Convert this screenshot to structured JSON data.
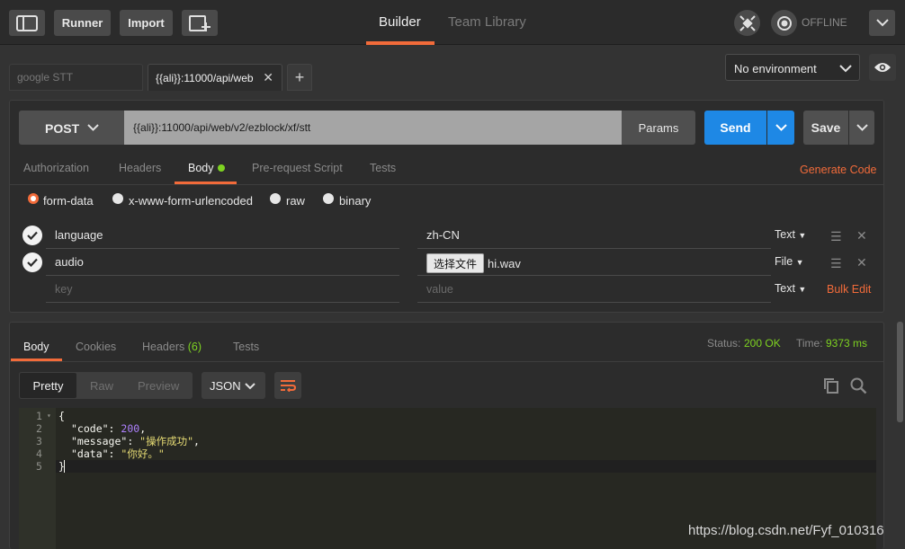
{
  "topbar": {
    "runner_label": "Runner",
    "import_label": "Import",
    "builder_tab": "Builder",
    "team_library_tab": "Team Library",
    "offline_label": "OFFLINE"
  },
  "request_tabs": [
    {
      "label": "google STT"
    },
    {
      "label": "{{ali}}:11000/api/web"
    }
  ],
  "environment": {
    "selected": "No environment"
  },
  "request": {
    "method": "POST",
    "url": "{{ali}}:11000/api/web/v2/ezblock/xf/stt",
    "params_label": "Params",
    "send_label": "Send",
    "save_label": "Save"
  },
  "request_subtabs": {
    "authorization": "Authorization",
    "headers": "Headers",
    "body": "Body",
    "prerequest": "Pre-request Script",
    "tests": "Tests",
    "generate_code": "Generate Code"
  },
  "body_modes": {
    "form_data": "form-data",
    "urlencoded": "x-www-form-urlencoded",
    "raw": "raw",
    "binary": "binary"
  },
  "form_rows": [
    {
      "key": "language",
      "value": "zh-CN",
      "type": "Text"
    },
    {
      "key": "audio",
      "file_button": "选择文件",
      "value": "hi.wav",
      "type": "File"
    }
  ],
  "form_new_row": {
    "key_placeholder": "key",
    "value_placeholder": "value",
    "type": "Text",
    "bulk_edit": "Bulk Edit"
  },
  "response_tabs": {
    "body": "Body",
    "cookies": "Cookies",
    "headers": "Headers",
    "headers_count": "(6)",
    "tests": "Tests"
  },
  "response_status": {
    "status_label": "Status:",
    "status_value": "200 OK",
    "time_label": "Time:",
    "time_value": "9373 ms"
  },
  "view_modes": {
    "pretty": "Pretty",
    "raw": "Raw",
    "preview": "Preview",
    "format": "JSON"
  },
  "response_body": {
    "line_numbers": [
      "1",
      "2",
      "3",
      "4",
      "5"
    ],
    "line1": "{",
    "code_key": "\"code\"",
    "code_value": "200",
    "message_key": "\"message\"",
    "message_value": "\"操作成功\"",
    "data_key": "\"data\"",
    "data_value": "\"你好。\"",
    "line5": "}"
  },
  "watermark": "https://blog.csdn.net/Fyf_010316",
  "colors": {
    "accent_orange": "#f26b3a",
    "send_blue": "#1e88e5",
    "success_green": "#7ed321",
    "code_background": "#272822"
  }
}
